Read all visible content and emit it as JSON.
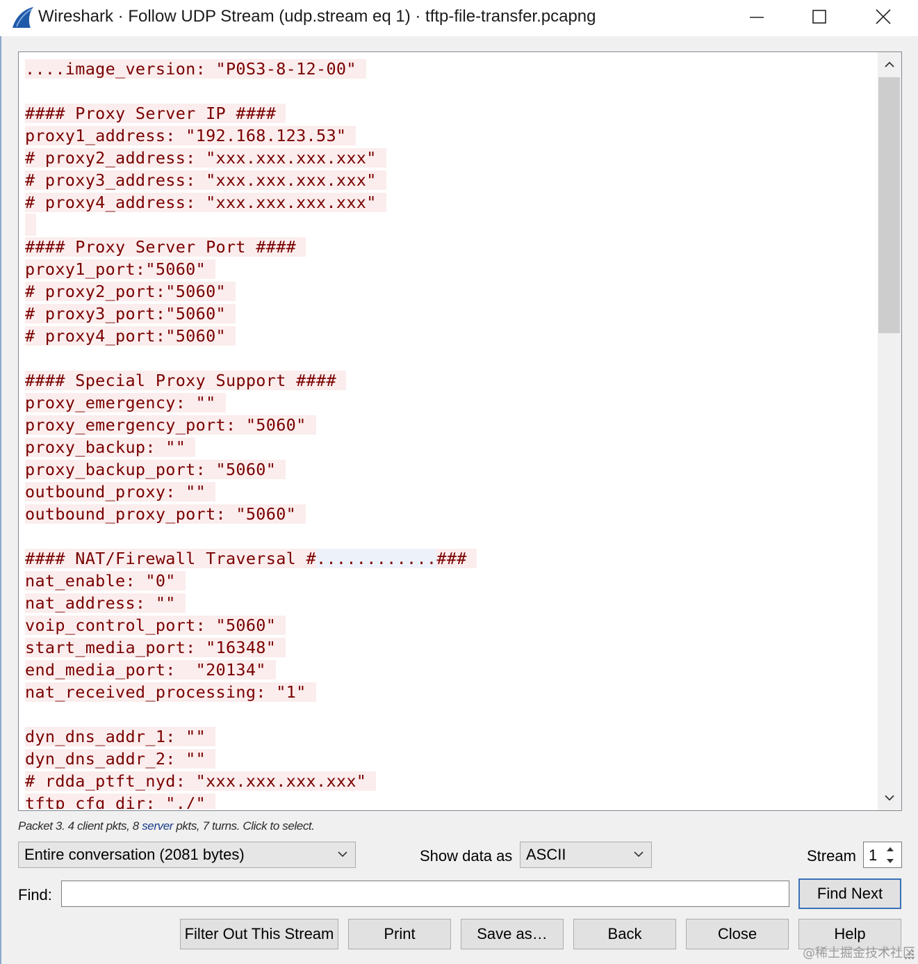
{
  "window": {
    "title": "Wireshark · Follow UDP Stream (udp.stream eq 1) · tftp-file-transfer.pcapng"
  },
  "stream": {
    "lines": [
      "....image_version: \"P0S3-8-12-00\"",
      "",
      "#### Proxy Server IP ####",
      "proxy1_address: \"192.168.123.53\"",
      "# proxy2_address: \"xxx.xxx.xxx.xxx\"",
      "# proxy3_address: \"xxx.xxx.xxx.xxx\"",
      "# proxy4_address: \"xxx.xxx.xxx.xxx\"",
      "",
      "#### Proxy Server Port ####",
      "proxy1_port:\"5060\"",
      "# proxy2_port:\"5060\"",
      "# proxy3_port:\"5060\"",
      "# proxy4_port:\"5060\"",
      "",
      "#### Special Proxy Support ####",
      "proxy_emergency: \"\"",
      "proxy_emergency_port: \"5060\"",
      "proxy_backup: \"\"",
      "proxy_backup_port: \"5060\"",
      "outbound_proxy: \"\"",
      "outbound_proxy_port: \"5060\"",
      "",
      "#### NAT/Firewall Traversal #",
      "nat_enable: \"0\"",
      "nat_address: \"\"",
      "voip_control_port: \"5060\"",
      "start_media_port: \"16348\"",
      "end_media_port:  \"20134\"",
      "nat_received_processing: \"1\"",
      "",
      "dyn_dns_addr_1: \"\"",
      "dyn_dns_addr_2: \"\"",
      "# rdda_ptft_nyd: \"xxx.xxx.xxx.xxx\"",
      "tftp_cfg_dir: \"./\""
    ],
    "nat_line": {
      "prefix": "#### NAT/Firewall Traversal #",
      "dots": "............",
      "suffix": "###"
    },
    "text_color": "#7a0000",
    "highlight_color": "#fbeded"
  },
  "status": {
    "prefix": "Packet 3. 4 client pkts, 8 ",
    "server": "server",
    "suffix": " pkts, 7 turns. Click to select."
  },
  "controls": {
    "conversation": "Entire conversation (2081 bytes)",
    "show_data_as_label": "Show data as",
    "show_data_as_value": "ASCII",
    "stream_label": "Stream",
    "stream_value": "1",
    "find_label": "Find:",
    "find_value": "",
    "find_next": "Find Next"
  },
  "buttons": {
    "filter_out": "Filter Out This Stream",
    "print": "Print",
    "save_as": "Save as…",
    "back": "Back",
    "close": "Close",
    "help": "Help"
  },
  "watermark": "@稀土掘金技术社区"
}
